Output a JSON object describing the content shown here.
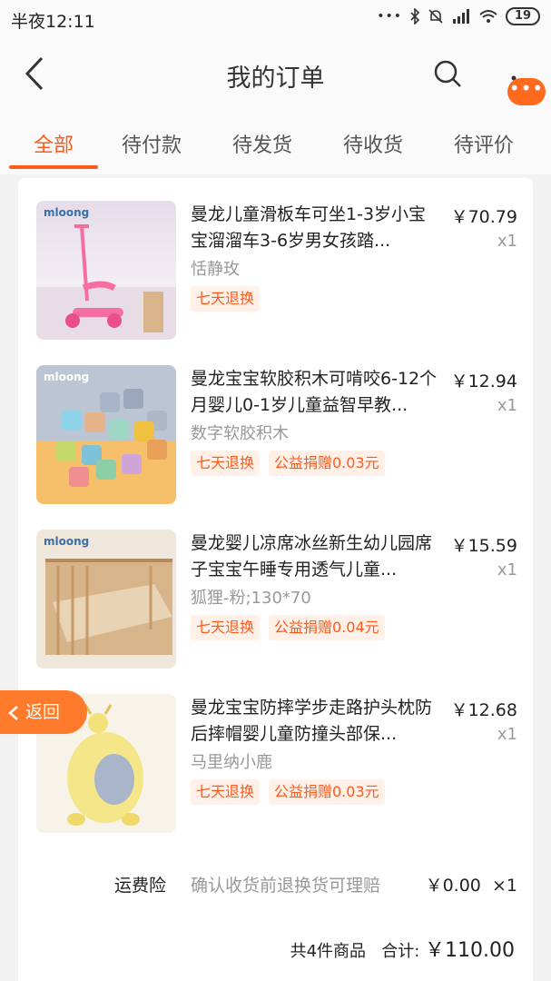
{
  "status": {
    "time": "半夜12:11",
    "battery": "19"
  },
  "nav": {
    "title": "我的订单"
  },
  "tabs": [
    "全部",
    "待付款",
    "待发货",
    "待收货",
    "待评价"
  ],
  "items": [
    {
      "brand": "mloong",
      "title": "曼龙儿童滑板车可坐1-3岁小宝宝溜溜车3-6岁男女孩踏...",
      "spec": "恬静玫",
      "price": "￥70.79",
      "qty": "x1",
      "tags": [
        "七天退换"
      ]
    },
    {
      "brand": "mloong",
      "title": "曼龙宝宝软胶积木可啃咬6-12个月婴儿0-1岁儿童益智早教...",
      "spec": "数字软胶积木",
      "price": "￥12.94",
      "qty": "x1",
      "tags": [
        "七天退换",
        "公益捐赠0.03元"
      ]
    },
    {
      "brand": "mloong",
      "title": "曼龙婴儿凉席冰丝新生幼儿园席子宝宝午睡专用透气儿童...",
      "spec": "狐狸-粉;130*70",
      "price": "￥15.59",
      "qty": "x1",
      "tags": [
        "七天退换",
        "公益捐赠0.04元"
      ]
    },
    {
      "brand": "",
      "title": "曼龙宝宝防摔学步走路护头枕防后摔帽婴儿童防撞头部保...",
      "spec": "马里纳小鹿",
      "price": "￥12.68",
      "qty": "x1",
      "tags": [
        "七天退换",
        "公益捐赠0.03元"
      ]
    }
  ],
  "shipping_insurance": {
    "label": "运费险",
    "desc": "确认收货前退换货可理赔",
    "price": "￥0.00",
    "qty": "×1"
  },
  "summary": {
    "count": "共4件商品",
    "label": "合计:",
    "total": "￥110.00"
  },
  "return_button": {
    "label": "返回"
  },
  "colors": {
    "accent": "#ff5a1c",
    "tag_bg": "#fff1e8",
    "return_bg": "#ff7a2a"
  }
}
